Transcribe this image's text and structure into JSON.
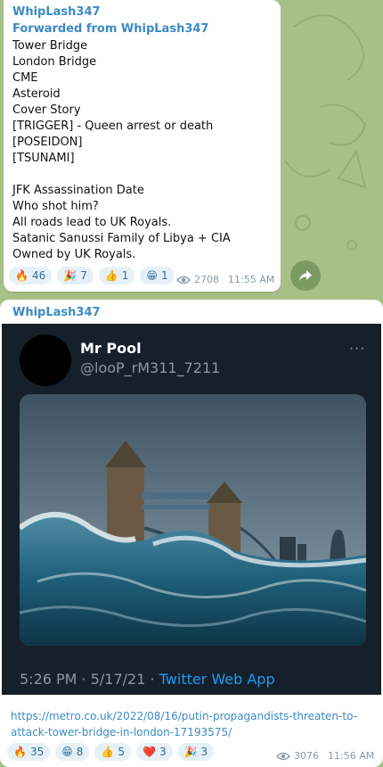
{
  "message1": {
    "author": "WhipLash347",
    "forwarded": "Forwarded from WhipLash347",
    "lines": [
      "Tower Bridge",
      "London Bridge",
      "CME",
      "Asteroid",
      "Cover Story",
      "[TRIGGER] - Queen arrest or death",
      "[POSEIDON]",
      "[TSUNAMI]",
      "",
      "JFK Assassination Date",
      "Who shot him?",
      "All roads lead to UK Royals.",
      "Satanic Sanussi Family of Libya + CIA",
      "Owned by UK Royals."
    ],
    "reactions": [
      {
        "emoji": "🔥",
        "count": "46"
      },
      {
        "emoji": "🎉",
        "count": "7"
      },
      {
        "emoji": "👍",
        "count": "1"
      },
      {
        "emoji": "😁",
        "count": "1"
      }
    ],
    "views": "2708",
    "time": "11:55 AM"
  },
  "message2": {
    "author": "WhipLash347",
    "tweet": {
      "name": "Mr Pool",
      "handle": "@looP_rM311_7211",
      "more": "···",
      "footer_time": "5:26 PM · 5/17/21 · ",
      "footer_app": "Twitter Web App"
    },
    "link": "https://metro.co.uk/2022/08/16/putin-propagandists-threaten-to-attack-tower-bridge-in-london-17193575/",
    "reactions": [
      {
        "emoji": "🔥",
        "count": "35"
      },
      {
        "emoji": "😁",
        "count": "8"
      },
      {
        "emoji": "👍",
        "count": "5"
      },
      {
        "emoji": "❤️",
        "count": "3"
      },
      {
        "emoji": "🎉",
        "count": "3"
      }
    ],
    "views": "3076",
    "time": "11:56 AM"
  },
  "colors": {
    "wallpaper": "#a6c088",
    "link": "#3b8ac4",
    "tweet_bg": "#15202b"
  }
}
